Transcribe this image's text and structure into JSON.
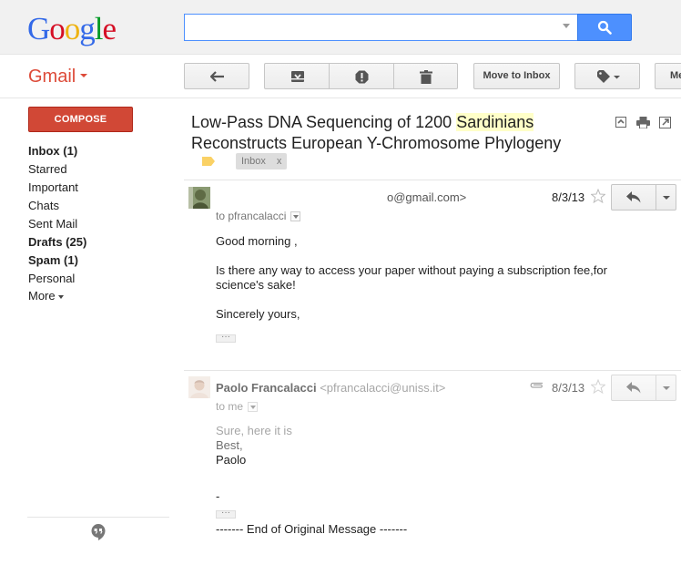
{
  "header": {
    "logo_letters": [
      "G",
      "o",
      "o",
      "g",
      "l",
      "e"
    ],
    "search": {
      "value": "",
      "placeholder": ""
    }
  },
  "toolbar": {
    "app_menu_label": "Gmail",
    "move_to_inbox_label": "Move to Inbox",
    "more_label": "Me"
  },
  "sidebar": {
    "compose_label": "COMPOSE",
    "items": [
      {
        "label": "Inbox (1)",
        "bold": true
      },
      {
        "label": "Starred",
        "bold": false
      },
      {
        "label": "Important",
        "bold": false
      },
      {
        "label": "Chats",
        "bold": false
      },
      {
        "label": "Sent Mail",
        "bold": false
      },
      {
        "label": "Drafts (25)",
        "bold": true
      },
      {
        "label": "Spam (1)",
        "bold": true
      },
      {
        "label": "Personal",
        "bold": false
      }
    ],
    "more_label": "More"
  },
  "conversation": {
    "subject_before": "Low-Pass DNA Sequencing of 1200 ",
    "subject_highlight": "Sardinians",
    "subject_after": " Reconstructs European Y-Chromosome Phylogeny",
    "label_chip": "Inbox",
    "label_chip_remove": "x",
    "messages": [
      {
        "sender_email": "o@gmail.com>",
        "date": "8/3/13",
        "to_line": "to pfrancalacci",
        "body": [
          "Good morning ,",
          "Is there any way  to access your paper without paying a subscription fee,for science's sake!",
          "Sincerely yours,"
        ],
        "ellipsis": "···"
      },
      {
        "sender_name": "Paolo Francalacci",
        "sender_email": "<pfrancalacci@uniss.it>",
        "date": "8/3/13",
        "to_line": "to me",
        "body_muted": "Sure, here it is",
        "body": [
          "Best,",
          "Paolo"
        ],
        "dash": "-",
        "ellipsis": "···",
        "footer": "------- End of Original Message -------"
      }
    ]
  },
  "colors": {
    "accent_blue": "#4d90fe",
    "compose_red": "#d14836",
    "gmail_red": "#dd4b39",
    "highlight": "#ffffc8"
  }
}
